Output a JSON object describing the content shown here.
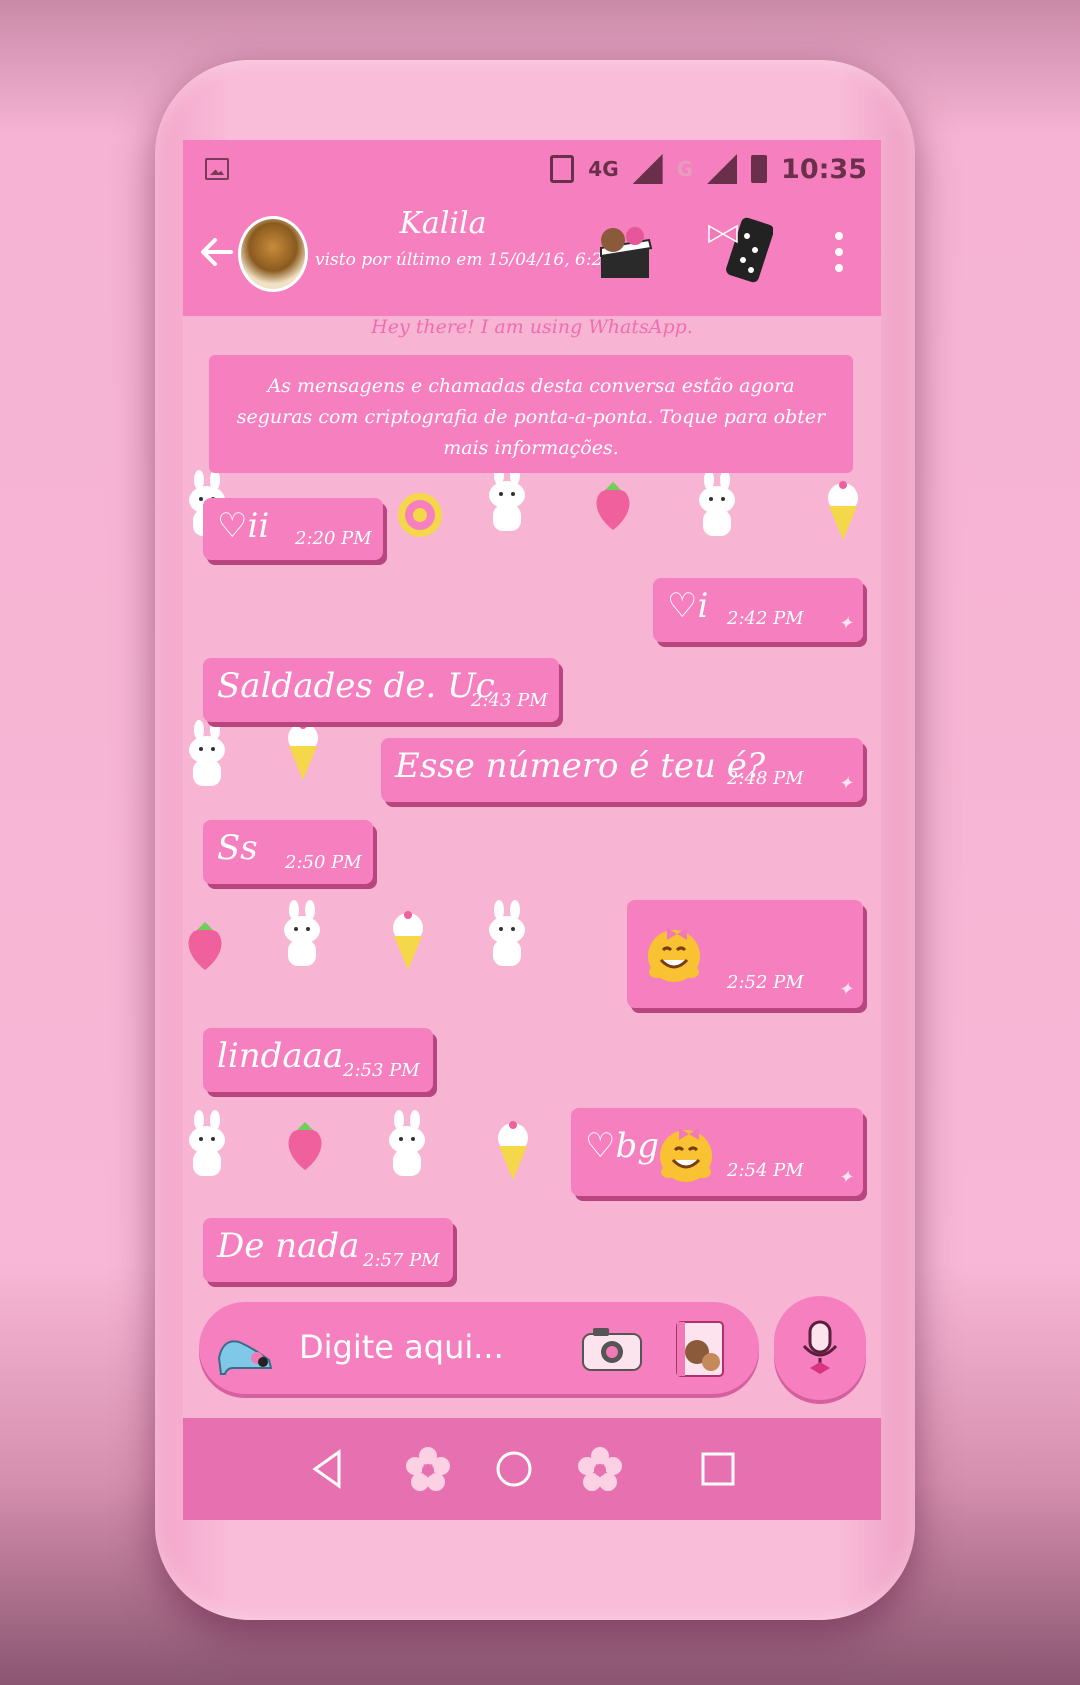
{
  "status_bar": {
    "network": "4G",
    "network2": "G",
    "time": "10:35"
  },
  "header": {
    "contact_name": "Kalila",
    "last_seen": "visto por último em 15/04/16, 6:21"
  },
  "contact_status": "Hey there! I am using WhatsApp.",
  "encryption_notice": "As mensagens e chamadas desta conversa estão agora seguras com criptografia de ponta-a-ponta. Toque para obter mais informações.",
  "messages": [
    {
      "text": "♡ii",
      "time": "2:20 PM",
      "direction": "in"
    },
    {
      "text": "♡i",
      "time": "2:42 PM",
      "direction": "out"
    },
    {
      "text": "Saldades de. Uc",
      "time": "2:43 PM",
      "direction": "in"
    },
    {
      "text": "Esse número é teu é?",
      "time": "2:48 PM",
      "direction": "out"
    },
    {
      "text": "Ss",
      "time": "2:50 PM",
      "direction": "in"
    },
    {
      "text": "",
      "time": "2:52 PM",
      "direction": "out",
      "emoji": "smiling-hug-emoji"
    },
    {
      "text": "lindaaa",
      "time": "2:53 PM",
      "direction": "in"
    },
    {
      "text": "♡bg",
      "time": "2:54 PM",
      "direction": "out",
      "emoji": "smiling-hug-emoji"
    },
    {
      "text": "De nada",
      "time": "2:57 PM",
      "direction": "in"
    }
  ],
  "input": {
    "placeholder": "Digite aqui..."
  },
  "icons": {
    "back": "back-arrow-icon",
    "menu": "more-vert-icon",
    "mic": "microphone-icon",
    "camera": "camera-icon",
    "gallery": "gallery-icon",
    "attach": "shoe-icon"
  },
  "colors": {
    "accent": "#f57fbf",
    "bubble_shadow": "#b9457e",
    "chat_bg": "#f8b4d3"
  }
}
